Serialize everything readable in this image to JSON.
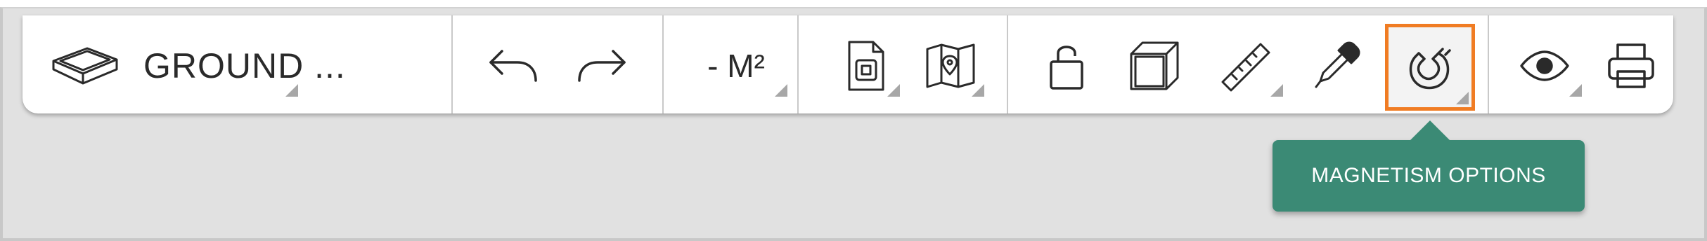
{
  "toolbar": {
    "floor_selector": {
      "icon": "floor-plane-icon",
      "label": "GROUND ..."
    },
    "history": {
      "undo_icon": "undo-icon",
      "redo_icon": "redo-icon"
    },
    "surface_unit": {
      "label": "- M²"
    },
    "export": {
      "document_icon": "document-export-icon",
      "map_icon": "map-export-icon"
    },
    "edit_tools": {
      "lock_icon": "unlock-icon",
      "box_icon": "3d-box-icon",
      "ruler_icon": "ruler-icon",
      "eyedropper_icon": "eyedropper-icon",
      "magnet_icon": "magnet-icon"
    },
    "view": {
      "visibility_icon": "eye-icon",
      "print_icon": "printer-icon"
    },
    "active_tool": "magnetism",
    "accent_color": "#f07c23"
  },
  "tooltip": {
    "text": "MAGNETISM OPTIONS",
    "background_color": "#3b8a75"
  }
}
